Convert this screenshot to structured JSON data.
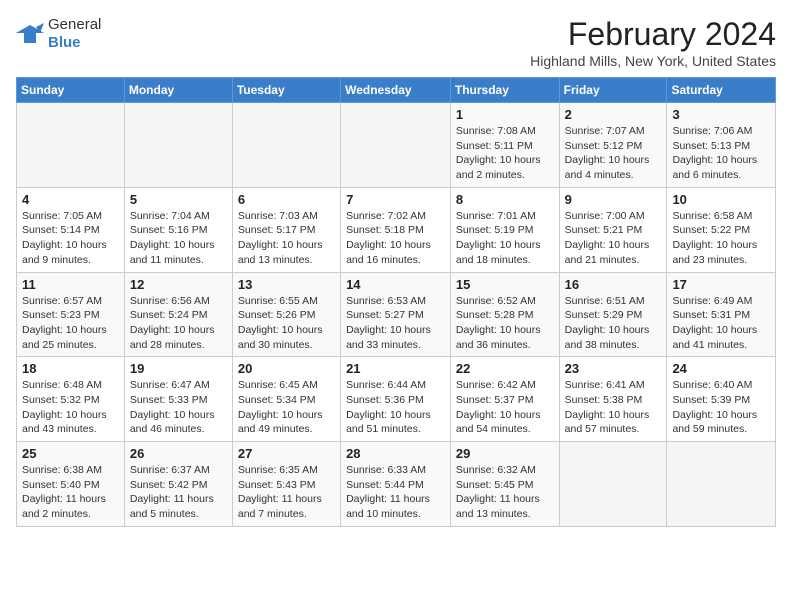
{
  "header": {
    "logo_general": "General",
    "logo_blue": "Blue",
    "month": "February 2024",
    "location": "Highland Mills, New York, United States"
  },
  "weekdays": [
    "Sunday",
    "Monday",
    "Tuesday",
    "Wednesday",
    "Thursday",
    "Friday",
    "Saturday"
  ],
  "weeks": [
    [
      {
        "day": "",
        "info": ""
      },
      {
        "day": "",
        "info": ""
      },
      {
        "day": "",
        "info": ""
      },
      {
        "day": "",
        "info": ""
      },
      {
        "day": "1",
        "info": "Sunrise: 7:08 AM\nSunset: 5:11 PM\nDaylight: 10 hours\nand 2 minutes."
      },
      {
        "day": "2",
        "info": "Sunrise: 7:07 AM\nSunset: 5:12 PM\nDaylight: 10 hours\nand 4 minutes."
      },
      {
        "day": "3",
        "info": "Sunrise: 7:06 AM\nSunset: 5:13 PM\nDaylight: 10 hours\nand 6 minutes."
      }
    ],
    [
      {
        "day": "4",
        "info": "Sunrise: 7:05 AM\nSunset: 5:14 PM\nDaylight: 10 hours\nand 9 minutes."
      },
      {
        "day": "5",
        "info": "Sunrise: 7:04 AM\nSunset: 5:16 PM\nDaylight: 10 hours\nand 11 minutes."
      },
      {
        "day": "6",
        "info": "Sunrise: 7:03 AM\nSunset: 5:17 PM\nDaylight: 10 hours\nand 13 minutes."
      },
      {
        "day": "7",
        "info": "Sunrise: 7:02 AM\nSunset: 5:18 PM\nDaylight: 10 hours\nand 16 minutes."
      },
      {
        "day": "8",
        "info": "Sunrise: 7:01 AM\nSunset: 5:19 PM\nDaylight: 10 hours\nand 18 minutes."
      },
      {
        "day": "9",
        "info": "Sunrise: 7:00 AM\nSunset: 5:21 PM\nDaylight: 10 hours\nand 21 minutes."
      },
      {
        "day": "10",
        "info": "Sunrise: 6:58 AM\nSunset: 5:22 PM\nDaylight: 10 hours\nand 23 minutes."
      }
    ],
    [
      {
        "day": "11",
        "info": "Sunrise: 6:57 AM\nSunset: 5:23 PM\nDaylight: 10 hours\nand 25 minutes."
      },
      {
        "day": "12",
        "info": "Sunrise: 6:56 AM\nSunset: 5:24 PM\nDaylight: 10 hours\nand 28 minutes."
      },
      {
        "day": "13",
        "info": "Sunrise: 6:55 AM\nSunset: 5:26 PM\nDaylight: 10 hours\nand 30 minutes."
      },
      {
        "day": "14",
        "info": "Sunrise: 6:53 AM\nSunset: 5:27 PM\nDaylight: 10 hours\nand 33 minutes."
      },
      {
        "day": "15",
        "info": "Sunrise: 6:52 AM\nSunset: 5:28 PM\nDaylight: 10 hours\nand 36 minutes."
      },
      {
        "day": "16",
        "info": "Sunrise: 6:51 AM\nSunset: 5:29 PM\nDaylight: 10 hours\nand 38 minutes."
      },
      {
        "day": "17",
        "info": "Sunrise: 6:49 AM\nSunset: 5:31 PM\nDaylight: 10 hours\nand 41 minutes."
      }
    ],
    [
      {
        "day": "18",
        "info": "Sunrise: 6:48 AM\nSunset: 5:32 PM\nDaylight: 10 hours\nand 43 minutes."
      },
      {
        "day": "19",
        "info": "Sunrise: 6:47 AM\nSunset: 5:33 PM\nDaylight: 10 hours\nand 46 minutes."
      },
      {
        "day": "20",
        "info": "Sunrise: 6:45 AM\nSunset: 5:34 PM\nDaylight: 10 hours\nand 49 minutes."
      },
      {
        "day": "21",
        "info": "Sunrise: 6:44 AM\nSunset: 5:36 PM\nDaylight: 10 hours\nand 51 minutes."
      },
      {
        "day": "22",
        "info": "Sunrise: 6:42 AM\nSunset: 5:37 PM\nDaylight: 10 hours\nand 54 minutes."
      },
      {
        "day": "23",
        "info": "Sunrise: 6:41 AM\nSunset: 5:38 PM\nDaylight: 10 hours\nand 57 minutes."
      },
      {
        "day": "24",
        "info": "Sunrise: 6:40 AM\nSunset: 5:39 PM\nDaylight: 10 hours\nand 59 minutes."
      }
    ],
    [
      {
        "day": "25",
        "info": "Sunrise: 6:38 AM\nSunset: 5:40 PM\nDaylight: 11 hours\nand 2 minutes."
      },
      {
        "day": "26",
        "info": "Sunrise: 6:37 AM\nSunset: 5:42 PM\nDaylight: 11 hours\nand 5 minutes."
      },
      {
        "day": "27",
        "info": "Sunrise: 6:35 AM\nSunset: 5:43 PM\nDaylight: 11 hours\nand 7 minutes."
      },
      {
        "day": "28",
        "info": "Sunrise: 6:33 AM\nSunset: 5:44 PM\nDaylight: 11 hours\nand 10 minutes."
      },
      {
        "day": "29",
        "info": "Sunrise: 6:32 AM\nSunset: 5:45 PM\nDaylight: 11 hours\nand 13 minutes."
      },
      {
        "day": "",
        "info": ""
      },
      {
        "day": "",
        "info": ""
      }
    ]
  ]
}
